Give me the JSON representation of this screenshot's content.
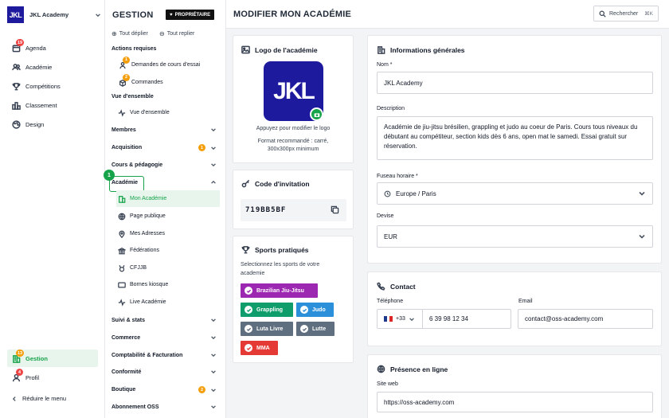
{
  "nav": {
    "brand": "JKL Academy",
    "logo_text": "JKL",
    "items": [
      {
        "label": "Agenda",
        "icon": "calendar-icon",
        "badge": "19"
      },
      {
        "label": "Académie",
        "icon": "users-icon"
      },
      {
        "label": "Compétitions",
        "icon": "trophy-icon"
      },
      {
        "label": "Classement",
        "icon": "ranking-icon"
      },
      {
        "label": "Design",
        "icon": "palette-icon"
      }
    ],
    "bottom": [
      {
        "label": "Gestion",
        "icon": "building-icon",
        "badge": "13"
      },
      {
        "label": "Profil",
        "icon": "user-icon",
        "badge": "4"
      }
    ],
    "collapse": "Réduire le menu"
  },
  "mgmt": {
    "title": "GESTION",
    "owner_badge": "PROPRIÉTAIRE",
    "expand_all": "Tout déplier",
    "collapse_all": "Tout replier",
    "sec_actions": "Actions requises",
    "actions": [
      {
        "label": "Demandes de cours d'essai",
        "badge": "1"
      },
      {
        "label": "Commandes",
        "badge": "2"
      }
    ],
    "sec_overview": "Vue d'ensemble",
    "overview": "Vue d'ensemble",
    "groups_top": [
      {
        "label": "Membres"
      },
      {
        "label": "Acquisition",
        "badge": "1"
      },
      {
        "label": "Cours & pédagogie"
      }
    ],
    "academie": "Académie",
    "step": "1",
    "academie_items": [
      "Mon Académie",
      "Page publique",
      "Mes Adresses",
      "Fédérations",
      "CFJJB",
      "Bornes kiosque",
      "Live Académie"
    ],
    "groups_bottom": [
      {
        "label": "Suivi & stats"
      },
      {
        "label": "Commerce"
      },
      {
        "label": "Comptabilité & Facturation"
      },
      {
        "label": "Conformité"
      },
      {
        "label": "Boutique",
        "badge": "2"
      },
      {
        "label": "Abonnement OSS"
      }
    ]
  },
  "header": {
    "title": "MODIFIER MON ACADÉMIE",
    "search": "Rechercher",
    "shortcut": "⌘K"
  },
  "logo_card": {
    "title": "Logo de l'académie",
    "logo_text": "JKL",
    "hint": "Appuyez pour modifier le logo",
    "format_line1": "Format recommandé : carré,",
    "format_line2": "300x300px minimum"
  },
  "invite_card": {
    "title": "Code d'invitation",
    "code": "719BB5BF"
  },
  "sports_card": {
    "title": "Sports pratiqués",
    "desc_line1": "Selectionnez les sports de votre",
    "desc_line2": "academie",
    "sports": [
      {
        "label": "Brazilian Jiu-Jitsu",
        "color": "#9c27b0"
      },
      {
        "label": "Grappling",
        "color": "#0f9d6b"
      },
      {
        "label": "Judo",
        "color": "#2b8fd9"
      },
      {
        "label": "Luta Livre",
        "color": "#5f6f7f"
      },
      {
        "label": "Lutte",
        "color": "#5f6f7f"
      },
      {
        "label": "MMA",
        "color": "#e53935"
      }
    ]
  },
  "general": {
    "title": "Informations générales",
    "name_label": "Nom *",
    "name_value": "JKL Academy",
    "desc_label": "Description",
    "desc_value": "Académie de jiu-jitsu brésilien, grappling et judo au coeur de Paris. Cours tous niveaux du débutant au compétiteur, section kids dès 6 ans, open mat le samedi. Essai gratuit sur réservation.",
    "tz_label": "Fuseau horaire *",
    "tz_value": "Europe / Paris",
    "currency_label": "Devise",
    "currency_value": "EUR"
  },
  "contact": {
    "title": "Contact",
    "phone_label": "Téléphone",
    "dial": "+33",
    "phone": "6 39 98 12 34",
    "email_label": "Email",
    "email": "contact@oss-academy.com"
  },
  "online": {
    "title": "Présence en ligne",
    "site_label": "Site web",
    "site": "https://oss-academy.com"
  },
  "colors": {
    "brand": "#1e1a9e",
    "active": "#16a34a",
    "active_bg": "#e8f5ec"
  }
}
